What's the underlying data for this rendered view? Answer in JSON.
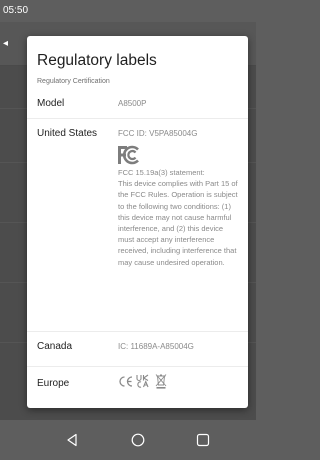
{
  "status_bar": {
    "time": "05:50"
  },
  "dialog": {
    "title": "Regulatory labels",
    "subtitle": "Regulatory Certification",
    "rows": [
      {
        "label": "Model",
        "value": "A8500P"
      },
      {
        "label": "United States",
        "value": "FCC ID: V5PA85004G",
        "statement_heading": "FCC 15.19a(3) statement:",
        "statement_body": "This device complies with Part 15 of the FCC Rules. Operation is subject to the following two conditions: (1) this device may not cause harmful interference, and (2) this device must accept any interference received, including interference that may cause undesired operation."
      },
      {
        "label": "Canada",
        "value": "IC: 11689A-A85004G"
      },
      {
        "label": "Europe"
      }
    ]
  },
  "icons": {
    "fcc": "fcc-logo-icon",
    "ce": "ce-mark-icon",
    "ukca": "ukca-mark-icon",
    "weee": "weee-bin-icon",
    "back": "back-triangle-icon",
    "home": "home-circle-icon",
    "recents": "recents-square-icon"
  },
  "colors": {
    "dialog_bg": "#ffffff",
    "scrim": "#5e5e5e",
    "title": "#1f1f1f",
    "value_text": "#8a8a8a"
  }
}
